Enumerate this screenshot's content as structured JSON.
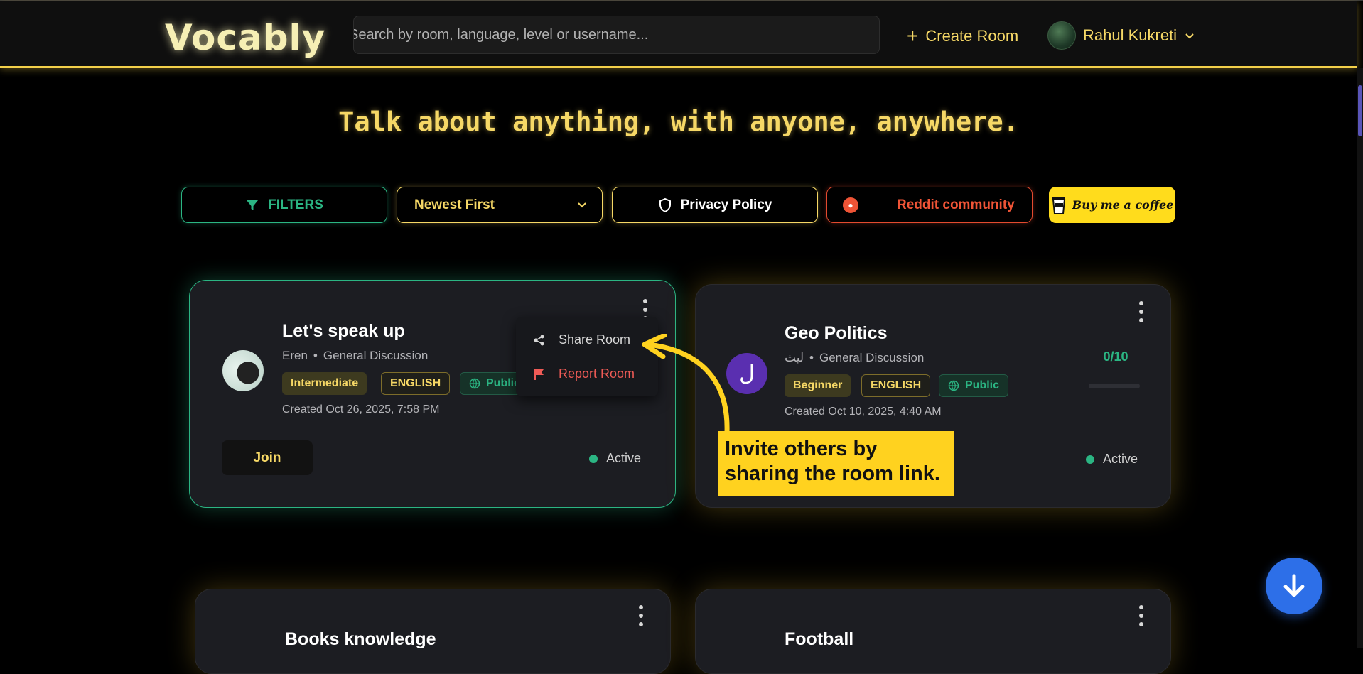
{
  "header": {
    "logo": "Vocably",
    "search_placeholder": "Search by room, language, level or username...",
    "create_room_label": "Create Room",
    "user_name": "Rahul Kukreti"
  },
  "headline": "Talk about anything, with anyone, anywhere.",
  "filter_bar": {
    "filters_label": "FILTERS",
    "sort_value": "Newest First",
    "privacy_label": "Privacy Policy",
    "reddit_label": "Reddit community",
    "coffee_label": "Buy me a coffee"
  },
  "rooms": [
    {
      "title": "Let's speak up",
      "host": "Eren",
      "category": "General Discussion",
      "level": "Intermediate",
      "language": "ENGLISH",
      "visibility": "Public",
      "created": "Created Oct 26, 2025, 7:58 PM",
      "join_label": "Join",
      "status": "Active"
    },
    {
      "title": "Geo Politics",
      "avatar_letter": "ل",
      "host": "ليث",
      "category": "General Discussion",
      "level": "Beginner",
      "language": "ENGLISH",
      "visibility": "Public",
      "created": "Created Oct 10, 2025, 4:40 AM",
      "capacity": "0/10",
      "status": "Active"
    },
    {
      "title": "Books knowledge"
    },
    {
      "title": "Football"
    }
  ],
  "room_menu": {
    "share_label": "Share Room",
    "report_label": "Report Room"
  },
  "callout": {
    "text": "Invite others by sharing the room link."
  },
  "colors": {
    "accent_yellow": "#f6d866",
    "accent_green": "#2bb583",
    "reddit_red": "#ef5436",
    "fab_blue": "#2d6fe8"
  }
}
